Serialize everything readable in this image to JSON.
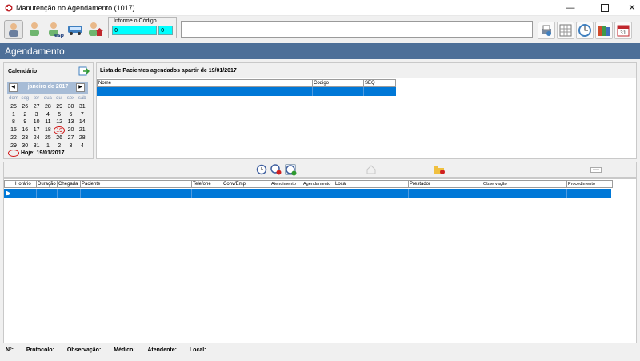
{
  "window": {
    "title": "Manutenção no Agendamento (1017)"
  },
  "code_box": {
    "label": "Informe o Código",
    "value1": "0",
    "value2": "0"
  },
  "header": {
    "title": "Agendamento"
  },
  "calendar": {
    "title": "Calendário",
    "month": "janeiro de 2017",
    "weekdays": [
      "dom",
      "seg",
      "ter",
      "qua",
      "qui",
      "sex",
      "sáb"
    ],
    "weeks": [
      [
        "25",
        "26",
        "27",
        "28",
        "29",
        "30",
        "31"
      ],
      [
        "1",
        "2",
        "3",
        "4",
        "5",
        "6",
        "7"
      ],
      [
        "8",
        "9",
        "10",
        "11",
        "12",
        "13",
        "14"
      ],
      [
        "15",
        "16",
        "17",
        "18",
        "19",
        "20",
        "21"
      ],
      [
        "22",
        "23",
        "24",
        "25",
        "26",
        "27",
        "28"
      ],
      [
        "29",
        "30",
        "31",
        "1",
        "2",
        "3",
        "4"
      ]
    ],
    "today_label": "Hoje: 19/01/2017"
  },
  "patients_list": {
    "title": "Lista de Pacientes agendados apartir de 19/01/2017",
    "columns": [
      "Nome",
      "Codigo",
      "SEQ"
    ]
  },
  "schedule_grid": {
    "columns": [
      "Horário",
      "Duração",
      "Chegada",
      "Paciente",
      "Telefone",
      "Conv/Emp",
      "Atendimento",
      "Agendamento",
      "Local",
      "Prestador",
      "Observação",
      "Procedimento"
    ]
  },
  "status_bar": {
    "nr": "Nº:",
    "protocolo": "Protocolo:",
    "observacao": "Observação:",
    "medico": "Médico:",
    "atendente": "Atendente:",
    "local": "Local:"
  },
  "colors": {
    "accent": "#0078d7",
    "header_bg": "#4d6f98",
    "code_input": "#00ffff"
  }
}
